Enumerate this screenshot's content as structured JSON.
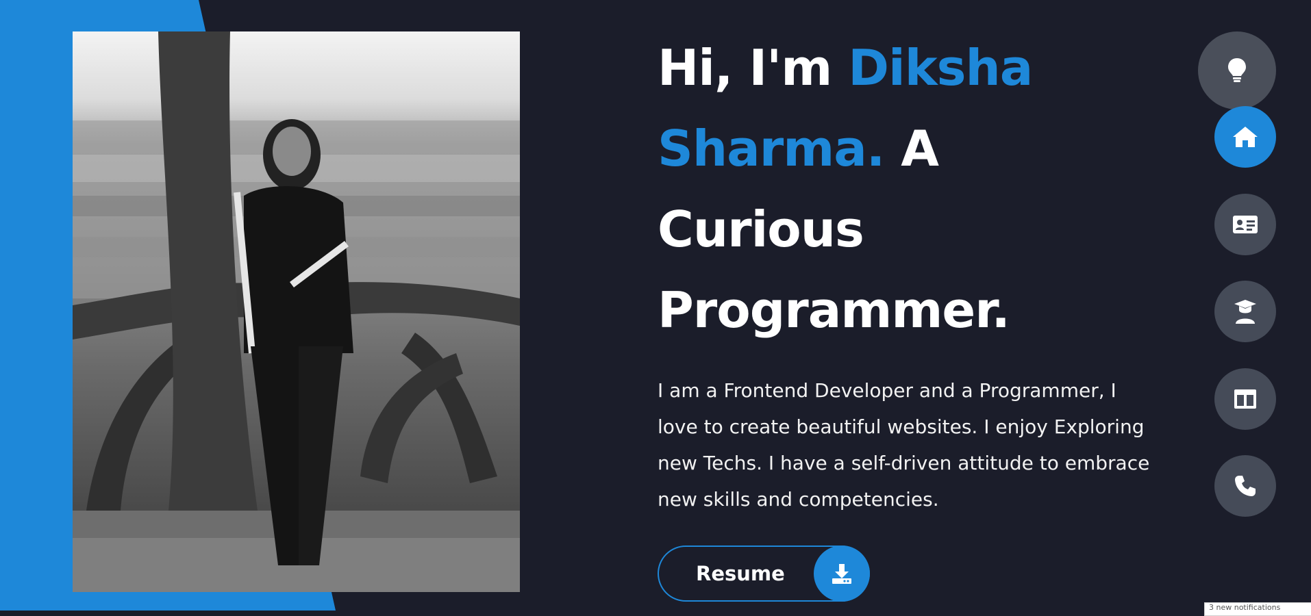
{
  "hero": {
    "greeting": "Hi, I'm ",
    "name_first": "Diksha",
    "name_last": "Sharma.",
    "tagline_a": " A",
    "tagline_b": "Curious",
    "tagline_c": "Programmer.",
    "bio": "I am a Frontend Developer and a Programmer, I love to create beautiful websites. I enjoy Exploring new Techs. I have a self-driven attitude to embrace new skills and competencies.",
    "resume_label": "Resume"
  },
  "nav": {
    "theme_icon": "lightbulb-icon",
    "items": [
      {
        "icon": "home-icon",
        "active": true
      },
      {
        "icon": "id-card-icon",
        "active": false
      },
      {
        "icon": "graduate-icon",
        "active": false
      },
      {
        "icon": "layout-icon",
        "active": false
      },
      {
        "icon": "phone-icon",
        "active": false
      }
    ]
  },
  "notification": {
    "text": "3 new notifications"
  },
  "colors": {
    "accent": "#1e88d9",
    "background": "#1b1d2a",
    "nav_button": "#454b58"
  }
}
